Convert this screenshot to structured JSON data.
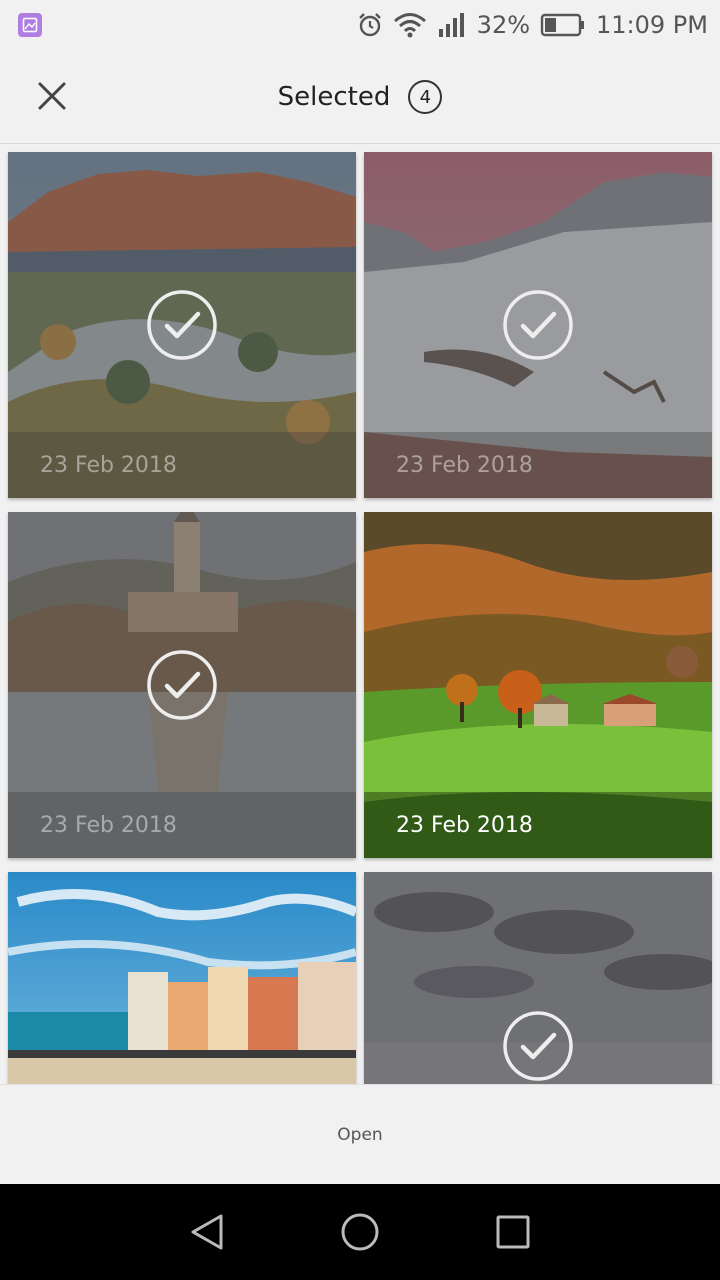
{
  "status_bar": {
    "battery_percent": "32%",
    "time": "11:09 PM",
    "icons": [
      "gallery-app-icon",
      "alarm-icon",
      "wifi-icon",
      "signal-icon",
      "battery-icon"
    ]
  },
  "header": {
    "title": "Selected",
    "selected_count": "4",
    "close_icon": "close-icon"
  },
  "photos": [
    {
      "date": "23 Feb 2018",
      "selected": true,
      "scene": "mountain-autumn-valley"
    },
    {
      "date": "23 Feb 2018",
      "selected": true,
      "scene": "snowy-mountains-dusk"
    },
    {
      "date": "23 Feb 2018",
      "selected": true,
      "scene": "lake-church-island"
    },
    {
      "date": "23 Feb 2018",
      "selected": false,
      "scene": "green-hills-farmhouse"
    },
    {
      "date": "",
      "selected": false,
      "scene": "coastal-village-sea"
    },
    {
      "date": "",
      "selected": true,
      "scene": "cloudy-sky-sea"
    }
  ],
  "action_bar": {
    "open_label": "Open"
  },
  "nav_bar": {
    "icons": [
      "back-icon",
      "home-icon",
      "recents-icon"
    ]
  },
  "colors": {
    "background": "#f1f1f1",
    "nav_bar": "#000000",
    "app_icon": "#b07ee0"
  }
}
